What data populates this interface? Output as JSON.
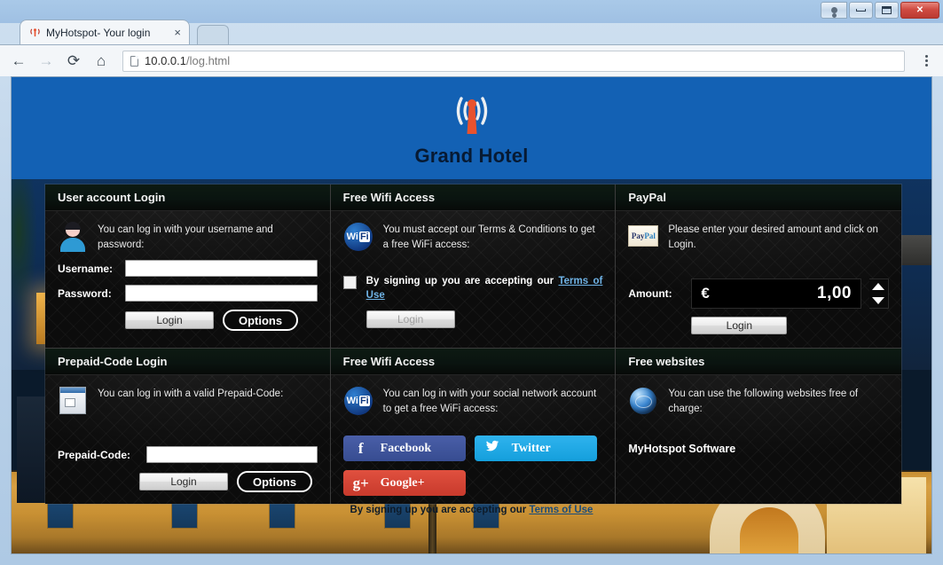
{
  "browser": {
    "tab_title": "MyHotspot- Your login",
    "tab_close_glyph": "×",
    "back_glyph": "←",
    "forward_glyph": "→",
    "reload_glyph": "⟳",
    "home_glyph": "⌂",
    "url_host": "10.0.0.1",
    "url_path": "/log.html",
    "close_glyph": "✕"
  },
  "site": {
    "hotel_name": "Grand Hotel",
    "logo_icon": "wifi-antenna-icon",
    "header_color": "#1361b4",
    "footer_text": "By signing up you are accepting our ",
    "footer_link": "Terms of Use"
  },
  "panels": [
    {
      "id": "user-account-login",
      "title": "User account Login",
      "icon": "user-avatar-icon",
      "intro": "You can log in with  your username  and password:",
      "fields": [
        {
          "label": "Username:",
          "value": "",
          "name": "username-input"
        },
        {
          "label": "Password:",
          "value": "",
          "name": "password-input"
        }
      ],
      "login_label": "Login",
      "options_label": "Options"
    },
    {
      "id": "free-wifi-terms",
      "title": "Free Wifi Access",
      "icon": "free-wifi-icon",
      "intro": "You must accept our Terms & Conditions to get a free WiFi access:",
      "checkbox_text": "By signing up you are accepting our ",
      "checkbox_link": "Terms of Use",
      "checkbox_checked": false,
      "login_label": "Login",
      "login_disabled": true
    },
    {
      "id": "paypal",
      "title": "PayPal",
      "icon": "paypal-icon",
      "intro": "Please enter your desired amount and click on Login.",
      "amount_label": "Amount:",
      "currency": "€",
      "amount_value": "1,00",
      "login_label": "Login"
    },
    {
      "id": "prepaid-code-login",
      "title": "Prepaid-Code Login",
      "icon": "prepaid-ticket-icon",
      "intro": "You can log in with a valid Prepaid-Code:",
      "fields": [
        {
          "label": "Prepaid-Code:",
          "value": "",
          "name": "prepaid-code-input"
        }
      ],
      "login_label": "Login",
      "options_label": "Options"
    },
    {
      "id": "free-wifi-social",
      "title": "Free Wifi Access",
      "icon": "free-wifi-icon",
      "intro": "You can log in with your social network account to get a free WiFi access:",
      "social": [
        {
          "label": "Facebook",
          "glyph": "f",
          "color": "#3b5998",
          "name": "facebook-login-button"
        },
        {
          "label": "Twitter",
          "glyph": "🐦",
          "color": "#1da1f2",
          "name": "twitter-login-button"
        },
        {
          "label": "Google+",
          "glyph": "g+",
          "color": "#d34836",
          "name": "googleplus-login-button"
        }
      ]
    },
    {
      "id": "free-websites",
      "title": "Free websites",
      "icon": "globe-icon",
      "intro": "You can use the  following websites  free of charge:",
      "link_label": "MyHotspot Software"
    }
  ]
}
